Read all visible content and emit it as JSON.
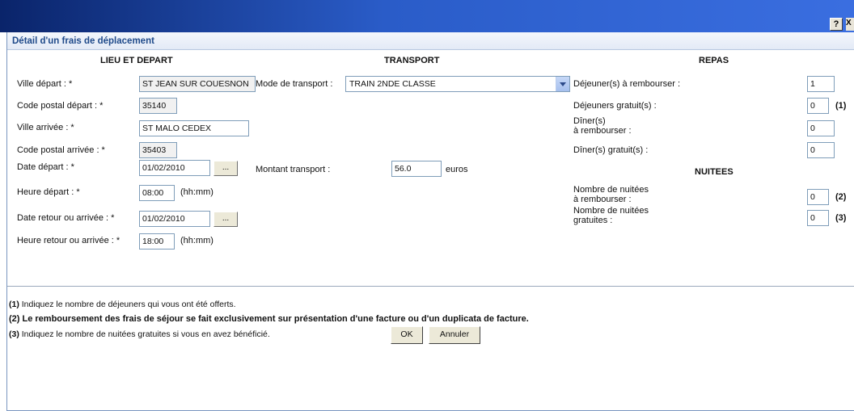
{
  "window": {
    "help_label": "?",
    "close_stub": "X"
  },
  "dialog": {
    "title": "Détail d'un frais de déplacement"
  },
  "sections": {
    "lieu": "LIEU ET DEPART",
    "transport": "TRANSPORT",
    "repas": "REPAS",
    "nuitees": "NUITEES"
  },
  "lieu": {
    "ville_depart": {
      "label": "Ville départ : *",
      "value": "ST JEAN SUR COUESNON"
    },
    "cp_depart": {
      "label": "Code postal départ : *",
      "value": "35140"
    },
    "ville_arrivee": {
      "label": "Ville arrivée : *",
      "value": "ST MALO CEDEX"
    },
    "cp_arrivee": {
      "label": "Code postal arrivée : *",
      "value": "35403"
    },
    "date_depart": {
      "label": "Date départ : *",
      "value": "01/02/2010",
      "button": "..."
    },
    "heure_depart": {
      "label": "Heure départ : *",
      "value": "08:00",
      "hint": "(hh:mm)"
    },
    "date_retour": {
      "label": "Date retour ou arrivée : *",
      "value": "01/02/2010",
      "button": "..."
    },
    "heure_retour": {
      "label": "Heure retour ou arrivée : *",
      "value": "18:00",
      "hint": "(hh:mm)"
    }
  },
  "transport": {
    "mode": {
      "label": "Mode de transport :",
      "value": "TRAIN 2NDE CLASSE"
    },
    "montant": {
      "label": "Montant transport :",
      "value": "56.0",
      "unit": "euros"
    }
  },
  "repas": {
    "dej_rembourser": {
      "label": "Déjeuner(s) à rembourser :",
      "value": "1"
    },
    "dej_gratuits": {
      "label": "Déjeuners gratuit(s) :",
      "value": "0",
      "note": "(1)"
    },
    "diner_rembourser": {
      "label_line1": "Dîner(s)",
      "label_line2": "à rembourser :",
      "value": "0"
    },
    "diner_gratuits": {
      "label": "Dîner(s) gratuit(s) :",
      "value": "0"
    }
  },
  "nuitees": {
    "a_rembourser": {
      "label_line1": "Nombre de nuitées",
      "label_line2": "à rembourser :",
      "value": "0",
      "note": "(2)"
    },
    "gratuites": {
      "label_line1": "Nombre de nuitées",
      "label_line2": "gratuites :",
      "value": "0",
      "note": "(3)"
    }
  },
  "notes": {
    "n1": {
      "mark": "(1)",
      "text": " Indiquez le nombre de déjeuners qui vous ont été offerts."
    },
    "n2": {
      "text": "(2) Le remboursement des frais de séjour se fait exclusivement sur présentation d'une facture ou d'un duplicata de facture."
    },
    "n3": {
      "mark": "(3)",
      "text": " Indiquez le nombre de nuitées gratuites si vous en avez bénéficié."
    }
  },
  "actions": {
    "ok": "OK",
    "cancel": "Annuler"
  }
}
